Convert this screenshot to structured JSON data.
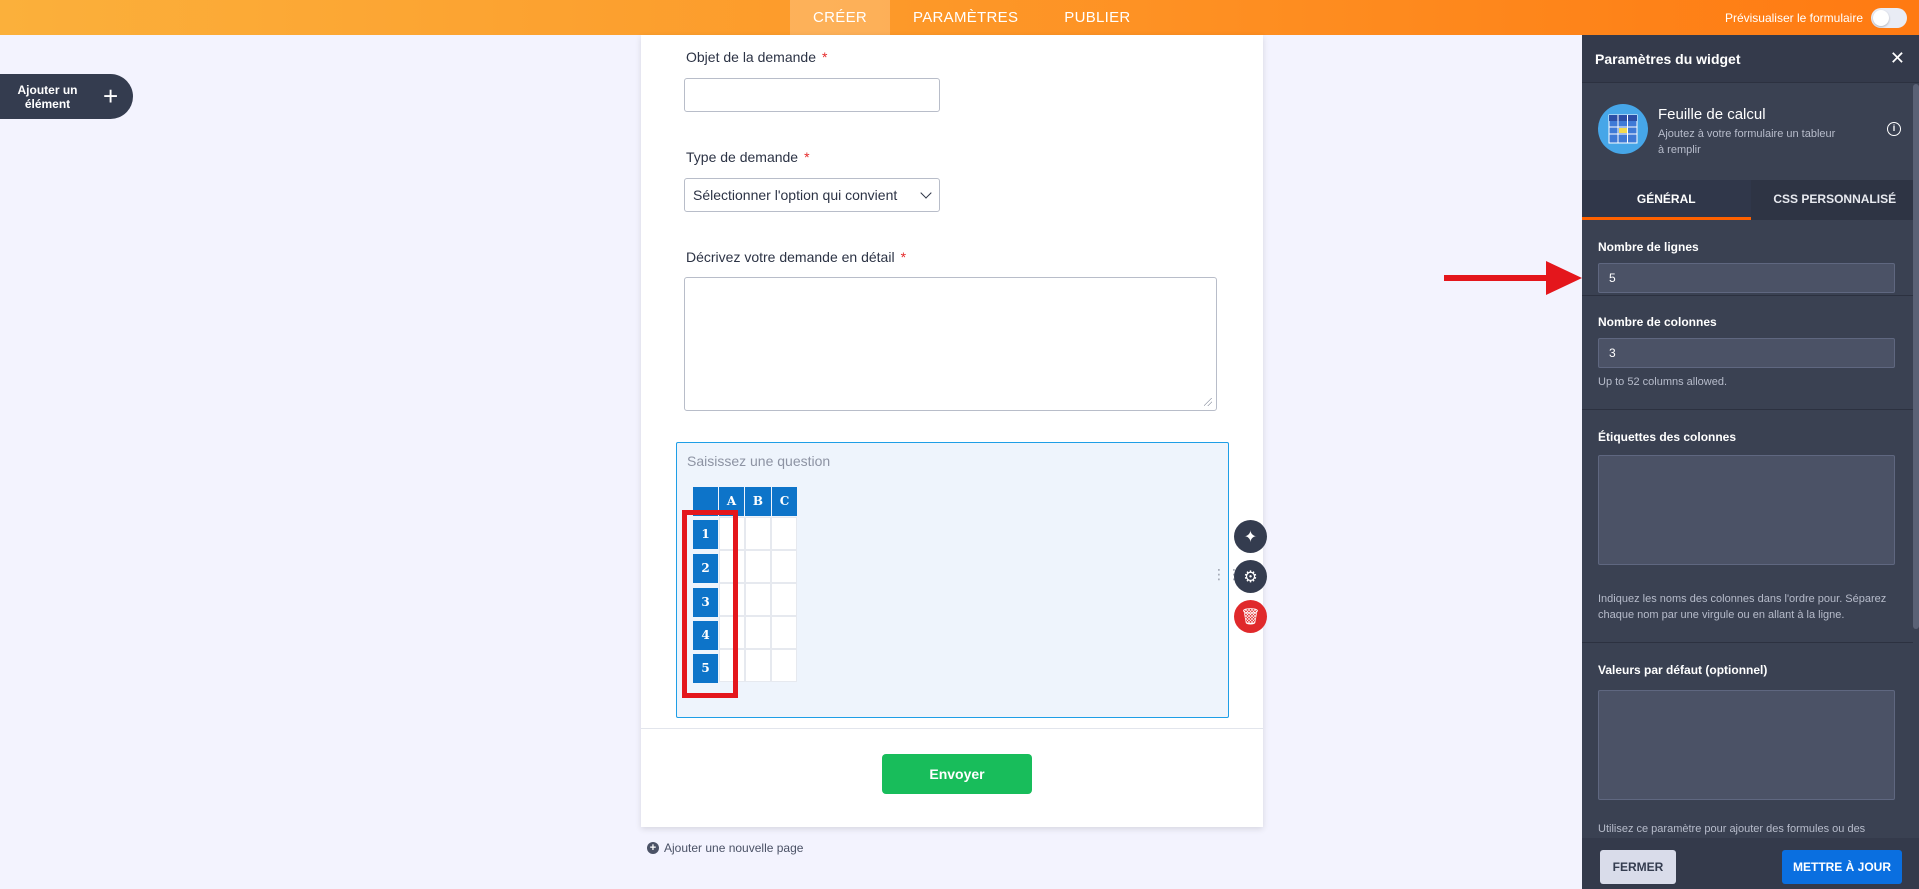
{
  "topbar": {
    "tabs": [
      {
        "label": "CRÉER",
        "active": true
      },
      {
        "label": "PARAMÈTRES",
        "active": false
      },
      {
        "label": "PUBLIER",
        "active": false
      }
    ],
    "preview_label": "Prévisualiser le formulaire",
    "preview_enabled": false
  },
  "left": {
    "add_element_line1": "Ajouter un",
    "add_element_line2": "élément",
    "add_element_icon": "plus-icon"
  },
  "form": {
    "q1": {
      "label": "Objet de la demande",
      "required": "*",
      "value": ""
    },
    "q2": {
      "label": "Type de demande",
      "required": "*",
      "selected": "Sélectionner l'option qui convient"
    },
    "q3": {
      "label": "Décrivez votre demande en détail",
      "required": "*",
      "value": ""
    },
    "spreadsheet": {
      "placeholder": "Saisissez une question",
      "columns": [
        "A",
        "B",
        "C"
      ],
      "rows": [
        "1",
        "2",
        "3",
        "4",
        "5"
      ]
    },
    "submit_label": "Envoyer",
    "add_page_label": "Ajouter une nouvelle page"
  },
  "widget_actions": [
    "wand-icon",
    "gear-icon",
    "trash-icon"
  ],
  "panel": {
    "title": "Paramètres du widget",
    "widget_name": "Feuille de calcul",
    "widget_desc": "Ajoutez à votre formulaire un tableur à remplir",
    "tabs": [
      {
        "label": "GÉNÉRAL",
        "active": true
      },
      {
        "label": "CSS PERSONNALISÉ",
        "active": false
      }
    ],
    "rows_label": "Nombre de lignes",
    "rows_value": "5",
    "cols_label": "Nombre de colonnes",
    "cols_value": "3",
    "cols_hint": "Up to 52 columns allowed.",
    "col_labels_label": "Étiquettes des colonnes",
    "col_labels_hint": "Indiquez les noms des colonnes dans l'ordre pour. Séparez chaque nom par une virgule ou en allant à la ligne.",
    "defaults_label": "Valeurs par défaut (optionnel)",
    "defaults_hint": "Utilisez ce paramètre pour ajouter des formules ou des",
    "close_label": "FERMER",
    "update_label": "METTRE À JOUR"
  },
  "colors": {
    "accent_orange": "#ff7a12",
    "sheet_blue": "#0d74c9",
    "submit_green": "#18bd5b",
    "annotation_red": "#e4161c",
    "update_blue": "#0a6fe0"
  }
}
